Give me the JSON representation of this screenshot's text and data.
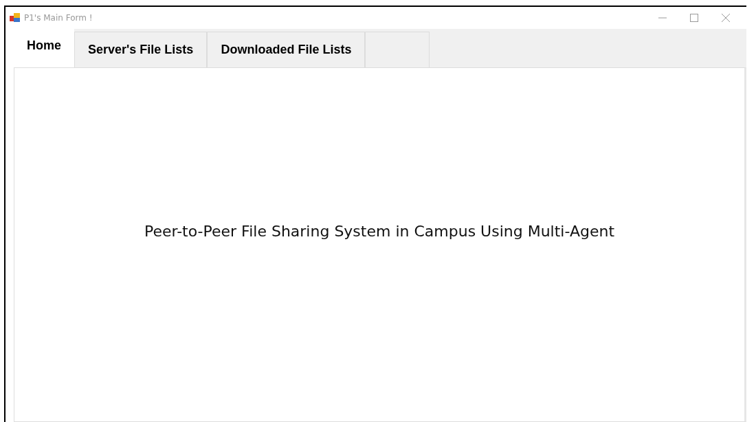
{
  "window": {
    "title": "P1's Main Form !"
  },
  "tabs": [
    {
      "label": "Home",
      "selected": true
    },
    {
      "label": "Server's File Lists",
      "selected": false
    },
    {
      "label": "Downloaded File Lists",
      "selected": false
    }
  ],
  "content": {
    "heading": "Peer-to-Peer File Sharing System in Campus Using Multi-Agent"
  }
}
